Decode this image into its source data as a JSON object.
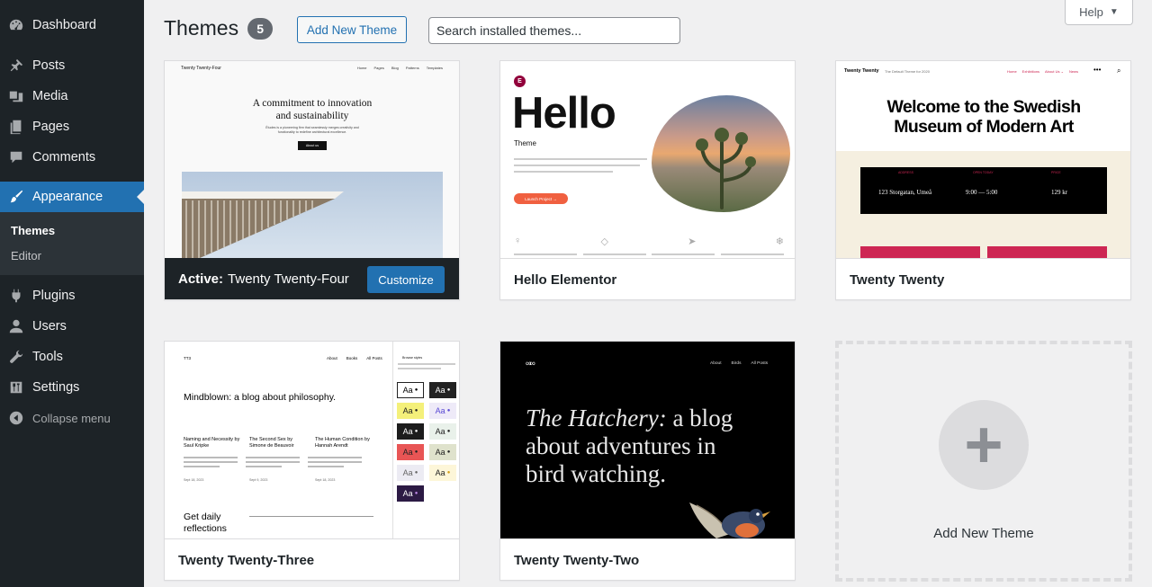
{
  "sidebar": {
    "items": [
      {
        "label": "Dashboard",
        "icon": "dashboard-icon"
      },
      {
        "label": "Posts",
        "icon": "pin-icon"
      },
      {
        "label": "Media",
        "icon": "media-icon"
      },
      {
        "label": "Pages",
        "icon": "pages-icon"
      },
      {
        "label": "Comments",
        "icon": "comment-icon"
      },
      {
        "label": "Appearance",
        "icon": "brush-icon"
      },
      {
        "label": "Plugins",
        "icon": "plug-icon"
      },
      {
        "label": "Users",
        "icon": "user-icon"
      },
      {
        "label": "Tools",
        "icon": "wrench-icon"
      },
      {
        "label": "Settings",
        "icon": "sliders-icon"
      }
    ],
    "submenu": [
      "Themes",
      "Editor"
    ],
    "collapse": "Collapse menu"
  },
  "header": {
    "title": "Themes",
    "count": "5",
    "add_new": "Add New Theme",
    "help": "Help"
  },
  "search": {
    "placeholder": "Search installed themes..."
  },
  "themes": [
    {
      "active_prefix": "Active:",
      "name": "Twenty Twenty-Four",
      "customize": "Customize",
      "preview": {
        "brand": "Twenty Twenty-Four",
        "nav": [
          "Home",
          "Pages",
          "Blog",
          "Patterns",
          "Templates"
        ],
        "heading": "A commitment to innovation and sustainability",
        "body": "Études is a pioneering firm that seamlessly merges creativity and functionality to redefine architectural excellence.",
        "button": "About us"
      }
    },
    {
      "name": "Hello Elementor",
      "preview": {
        "badge": "E",
        "title": "Hello",
        "subtitle": "Theme",
        "button": "Launch Project →"
      }
    },
    {
      "name": "Twenty Twenty",
      "preview": {
        "brand": "Twenty Twenty",
        "tagline": "The Default Theme for 2020",
        "nav": [
          "Home",
          "Exhibitions",
          "About Us ⌄",
          "News"
        ],
        "heading": "Welcome to the Swedish Museum of Modern Art",
        "labels": [
          "ADDRESS",
          "OPEN TODAY",
          "PRICE"
        ],
        "values": [
          "123 Storgatan, Umeå",
          "9:00 — 5:00",
          "129 kr"
        ]
      }
    },
    {
      "name": "Twenty Twenty-Three",
      "preview": {
        "brand": "TT3",
        "nav": [
          "About",
          "Books",
          "All Posts"
        ],
        "heading": "Mindblown: a blog about philosophy.",
        "posts": [
          {
            "title": "Naming and Necessity by Saul Kripke",
            "date": "Sept 18, 2023"
          },
          {
            "title": "The Second Sex by Simone de Beauvoir",
            "date": "Sept 9, 2023"
          },
          {
            "title": "The Human Condition by Hannah Arendt",
            "date": "Sept 18, 2023"
          }
        ],
        "footer": "Get daily reflections",
        "styles_title": "Browse styles",
        "swatch": "Aa"
      }
    },
    {
      "name": "Twenty Twenty-Two",
      "preview": {
        "nav": [
          "About",
          "Birds",
          "All Posts"
        ],
        "heading_em": "The Hatchery:",
        "heading": " a blog about adventures in bird watching."
      }
    }
  ],
  "add_card": {
    "label": "Add New Theme"
  },
  "colors": {
    "sidebar": "#1d2327",
    "accent": "#2271b1",
    "background": "#f0f0f1"
  }
}
